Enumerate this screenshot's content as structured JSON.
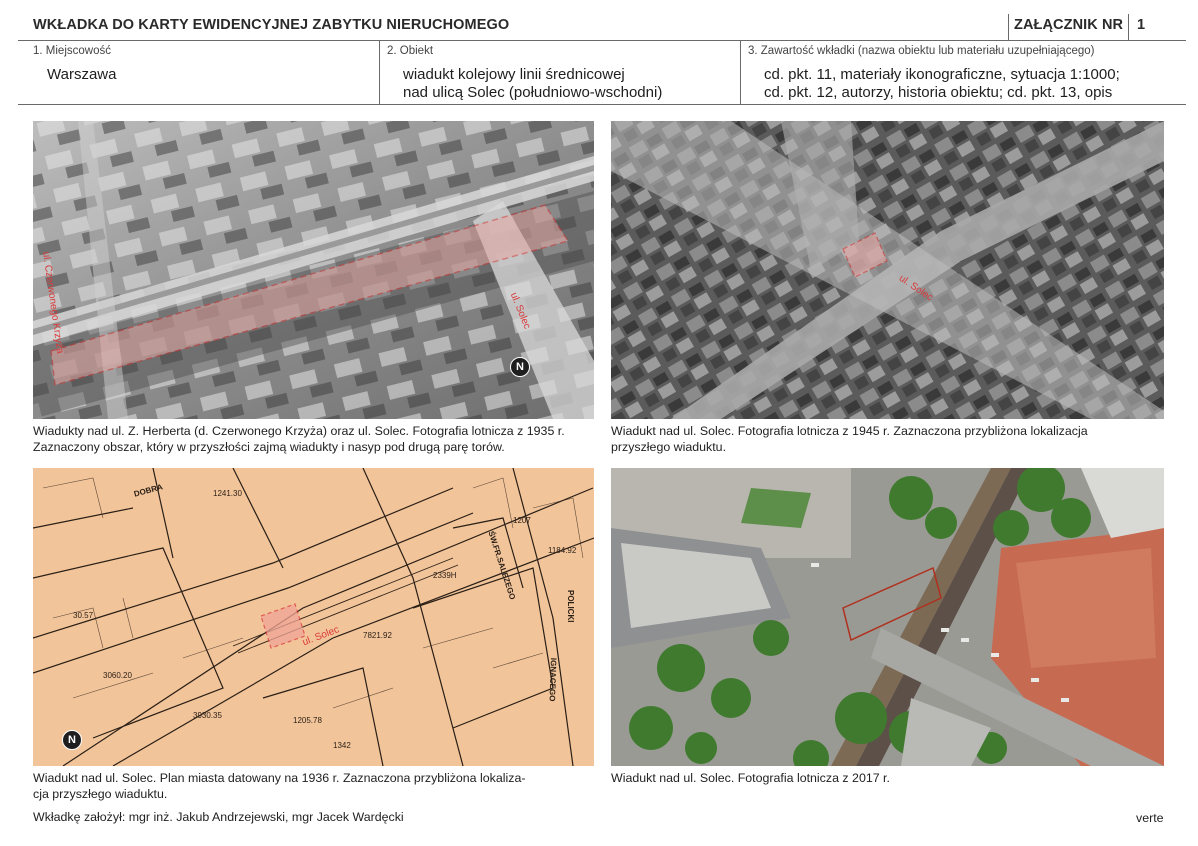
{
  "header": {
    "title": "WKŁADKA DO KARTY EWIDENCYJNEJ ZABYTKU NIERUCHOMEGO",
    "attachment_label": "ZAŁĄCZNIK NR",
    "attachment_number": "1"
  },
  "fields": {
    "locality_label": "1. Miejscowość",
    "locality_value": "Warszawa",
    "object_label": "2. Obiekt",
    "object_value_1": "wiadukt kolejowy linii średnicowej",
    "object_value_2": "nad ulicą Solec (południowo-wschodni)",
    "contents_label": "3. Zawartość wkładki (nazwa obiektu lub materiału uzupełniającego)",
    "contents_value_1": "cd. pkt. 11, materiały ikonograficzne, sytuacja 1:1000;",
    "contents_value_2": "cd. pkt. 12, autorzy, historia obiektu; cd. pkt. 13, opis"
  },
  "images": [
    {
      "caption_1": "Wiadukty nad ul. Z. Herberta (d. Czerwonego Krzyża) oraz ul. Solec. Fotografia lotnicza z 1935 r.",
      "caption_2": "Zaznaczony obszar, który w przyszłości zajmą wiadukty i nasyp pod drugą parę torów.",
      "street_label_1": "ul. Czerwonego Krzyża",
      "street_label_2": "ul. Solec",
      "north_label": "N"
    },
    {
      "caption_1": "Wiadukt nad ul. Solec. Fotografia lotnicza z 1945 r. Zaznaczona przybliżona lokalizacja",
      "caption_2": "przyszłego wiaduktu.",
      "street_label": "ul. Solec"
    },
    {
      "caption_1": "Wiadukt nad ul. Solec. Plan miasta datowany na 1936 r. Zaznaczona przybliżona lokaliza-",
      "caption_2": "cja przyszłego wiaduktu.",
      "street_label": "ul. Solec",
      "north_label": "N",
      "map_text_1": "ŚW.FR.SALEZEGO",
      "map_text_2": "IGNACEGO",
      "map_text_3": "POLICKI",
      "map_text_4": "DOBRA"
    },
    {
      "caption_1": "Wiadukt nad ul. Solec. Fotografia lotnicza z 2017 r."
    }
  ],
  "footer": {
    "author": "Wkładkę założył: mgr inż. Jakub Andrzejewski, mgr Jacek Wardęcki",
    "verte": "verte"
  },
  "colors": {
    "marker": "#d93a3a",
    "map_paper": "#f2c49a",
    "rule": "#6a6a6a"
  }
}
